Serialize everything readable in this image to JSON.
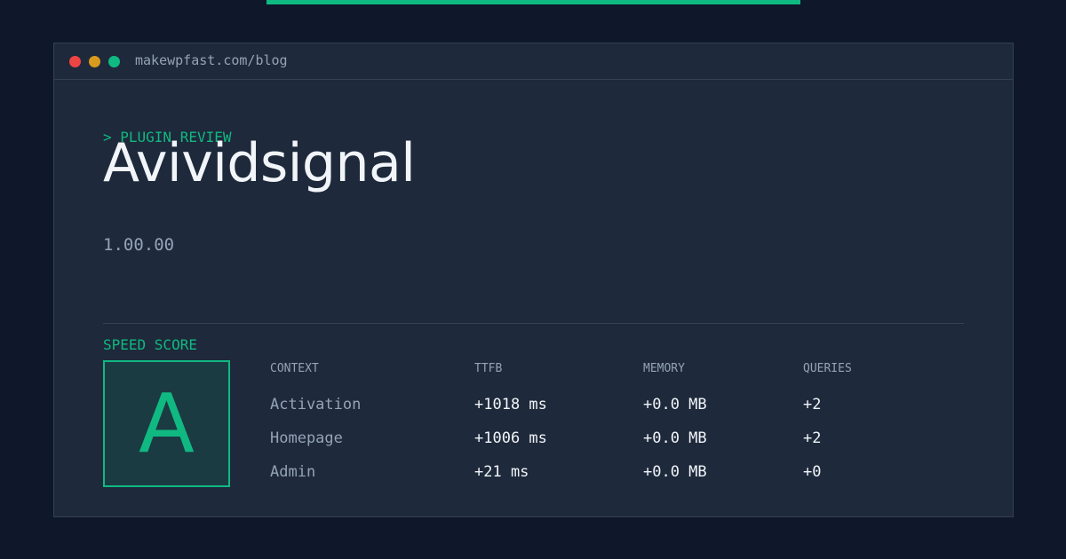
{
  "window": {
    "url": "makewpfast.com/blog"
  },
  "hero": {
    "eyebrow": "> PLUGIN REVIEW",
    "plugin_name": "Avividsignal",
    "version": "1.00.00"
  },
  "score": {
    "label": "SPEED SCORE",
    "grade": "A"
  },
  "table": {
    "headers": [
      "CONTEXT",
      "TTFB",
      "MEMORY",
      "QUERIES"
    ],
    "rows": [
      [
        "Activation",
        "+1018 ms",
        "+0.0 MB",
        "+2"
      ],
      [
        "Homepage",
        "+1006 ms",
        "+0.0 MB",
        "+2"
      ],
      [
        "Admin",
        "+21 ms",
        "+0.0 MB",
        "+0"
      ]
    ]
  },
  "colors": {
    "background": "#0f172a",
    "panel": "#1e293b",
    "accent": "#10b981",
    "dot_red": "#ef4444",
    "dot_yellow": "#d99a1e",
    "dot_green": "#10b981"
  }
}
